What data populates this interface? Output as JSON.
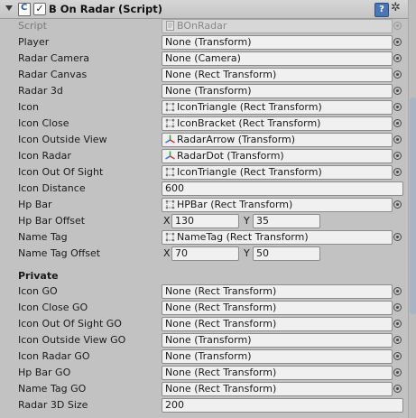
{
  "component": {
    "title": "B On Radar (Script)",
    "enabled_check": "✓"
  },
  "icons": {
    "help": "?",
    "gear": "✲"
  },
  "fields": [
    {
      "label": "Script",
      "value": "BOnRadar",
      "disabled": true,
      "icon": "script-file-icon"
    },
    {
      "label": "Player",
      "value": "None (Transform)"
    },
    {
      "label": "Radar Camera",
      "value": "None (Camera)"
    },
    {
      "label": "Radar Canvas",
      "value": "None (Rect Transform)"
    },
    {
      "label": "Radar 3d",
      "value": "None (Transform)"
    },
    {
      "label": "Icon",
      "value": "IconTriangle (Rect Transform)",
      "icon": "rect-transform-icon"
    },
    {
      "label": "Icon Close",
      "value": "IconBracket (Rect Transform)",
      "icon": "rect-transform-icon"
    },
    {
      "label": "Icon Outside View",
      "value": "RadarArrow (Transform)",
      "icon": "transform-icon"
    },
    {
      "label": "Icon Radar",
      "value": "RadarDot (Transform)",
      "icon": "transform-icon"
    },
    {
      "label": "Icon Out Of Sight",
      "value": "IconTriangle (Rect Transform)",
      "icon": "rect-transform-icon"
    },
    {
      "label": "Icon Distance",
      "value": "600",
      "number": true
    },
    {
      "label": "Hp Bar",
      "value": "HPBar (Rect Transform)",
      "icon": "rect-transform-icon"
    },
    {
      "label": "Hp Bar Offset",
      "vector": {
        "x_label": "X",
        "x": "130",
        "y_label": "Y",
        "y": "35"
      }
    },
    {
      "label": "Name Tag",
      "value": "NameTag (Rect Transform)",
      "icon": "rect-transform-icon"
    },
    {
      "label": "Name Tag Offset",
      "vector": {
        "x_label": "X",
        "x": "70",
        "y_label": "Y",
        "y": "50"
      }
    }
  ],
  "private_section": "Private",
  "private_fields": [
    {
      "label": "Icon GO",
      "value": "None (Rect Transform)"
    },
    {
      "label": "Icon Close GO",
      "value": "None (Rect Transform)"
    },
    {
      "label": "Icon Out Of Sight GO",
      "value": "None (Rect Transform)"
    },
    {
      "label": "Icon Outside View GO",
      "value": "None (Transform)"
    },
    {
      "label": "Icon Radar GO",
      "value": "None (Transform)"
    },
    {
      "label": "Hp Bar GO",
      "value": "None (Rect Transform)"
    },
    {
      "label": "Name Tag GO",
      "value": "None (Rect Transform)"
    },
    {
      "label": "Radar 3D Size",
      "value": "200",
      "number": true
    }
  ]
}
